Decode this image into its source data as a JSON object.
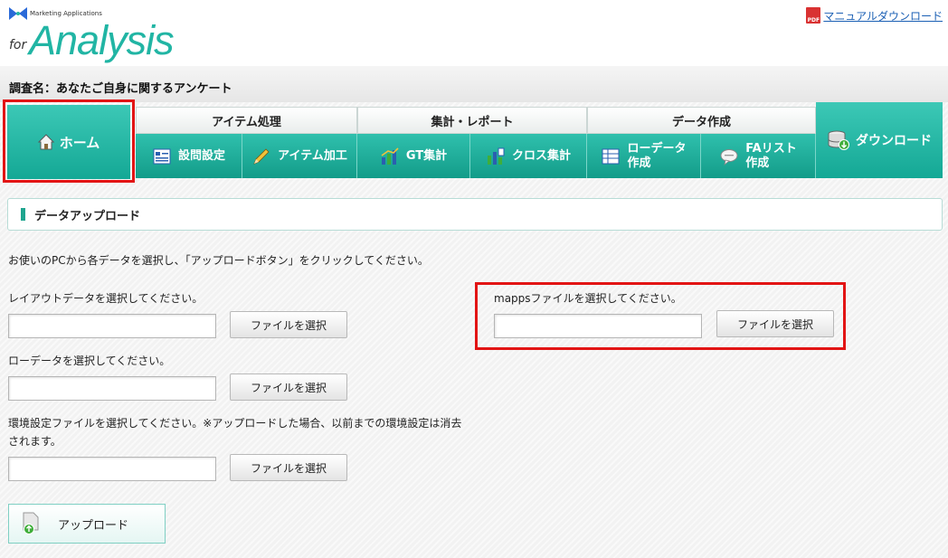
{
  "brand": {
    "tagline": "Marketing Applications",
    "prefix": "for",
    "name": "Analysis"
  },
  "header": {
    "manual_link": "マニュアルダウンロード",
    "pdf_badge": "PDF"
  },
  "survey": {
    "label": "調査名：あなたご自身に関するアンケート"
  },
  "nav": {
    "home": "ホーム",
    "groups": {
      "item": "アイテム処理",
      "report": "集計・レポート",
      "data": "データ作成"
    },
    "tabs": {
      "question_settings": "設問設定",
      "item_edit": "アイテム加工",
      "gt": "GT集計",
      "cross": "クロス集計",
      "raw_data": [
        "ローデータ",
        "作成"
      ],
      "fa_list": [
        "FAリスト",
        "作成"
      ]
    },
    "download": "ダウンロード"
  },
  "section": {
    "title": "データアップロード"
  },
  "instructions": "お使いのPCから各データを選択し、「アップロードボタン」をクリックしてください。",
  "fields": {
    "layout": {
      "label": "レイアウトデータを選択してください。",
      "value": "",
      "button": "ファイルを選択"
    },
    "raw": {
      "label": "ローデータを選択してください。",
      "value": "",
      "button": "ファイルを選択"
    },
    "env": {
      "label_line1": "環境設定ファイルを選択してください。※アップロードした場合、以前までの環境設定は消去",
      "label_line2": "されます。",
      "value": "",
      "button": "ファイルを選択"
    },
    "mapps": {
      "label": "mappsファイルを選択してください。",
      "value": "",
      "button": "ファイルを選択"
    }
  },
  "upload_button": "アップロード",
  "colors": {
    "teal": "#1fb09c",
    "highlight": "#e21414",
    "link": "#1a5fb4"
  }
}
